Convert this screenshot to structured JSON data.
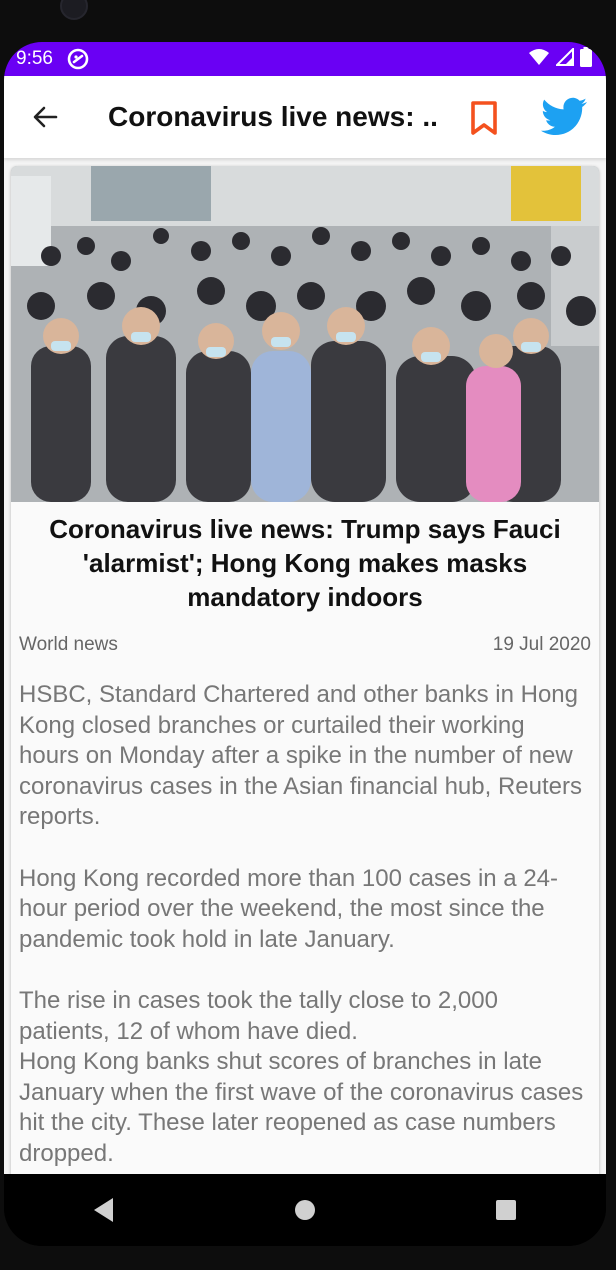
{
  "status_bar": {
    "time": "9:56",
    "background_color": "#6a00f4",
    "icons": [
      "app-notification-icon",
      "wifi-icon",
      "cellular-signal-icon",
      "battery-icon"
    ]
  },
  "app_bar": {
    "title": "Coronavirus live news: ...",
    "back_icon": "arrow-left-icon",
    "bookmark_icon": "bookmark-outline-icon",
    "bookmark_color": "#f4511e",
    "twitter_icon": "twitter-bird-icon",
    "twitter_color": "#1da1f2"
  },
  "article": {
    "image_description_icon": "crowd-photo",
    "headline": "Coronavirus live news: Trump says Fauci 'alarmist'; Hong Kong makes masks mandatory indoors",
    "section": "World news",
    "date": "19 Jul 2020",
    "body": "HSBC, Standard Chartered and other banks in Hong Kong closed branches or curtailed their working hours on Monday after a spike in the number of new coronavirus cases in the Asian financial hub, Reuters reports.\n\nHong Kong recorded more than 100 cases in a 24-hour period over the weekend, the most since the pandemic took hold in late January.\n\nThe rise in cases took the tally close to 2,000 patients, 12 of whom have died.\nHong Kong banks shut scores of branches in late January when the first wave of the coronavirus cases hit the city. These later reopened as case numbers dropped."
  },
  "nav_bar": {
    "icons": [
      "back-triangle-icon",
      "home-circle-icon",
      "recents-square-icon"
    ]
  }
}
